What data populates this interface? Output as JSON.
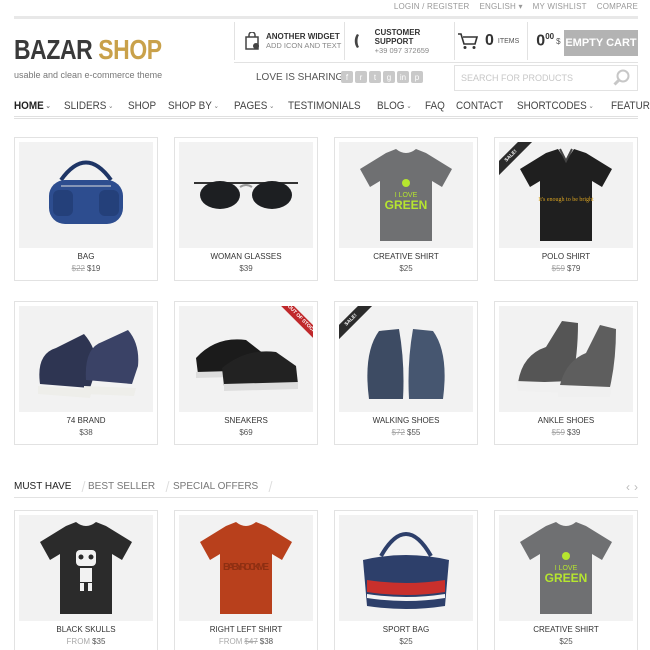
{
  "top_links": [
    "LOGIN / REGISTER",
    "ENGLISH ▾",
    "MY WISHLIST",
    "COMPARE"
  ],
  "logo": {
    "part1": "BAZAR",
    "part2": "SHOP",
    "tagline": "usable and clean e-commerce theme"
  },
  "widgets": [
    {
      "title": "ANOTHER WIDGET",
      "subtitle": "ADD ICON AND TEXT",
      "icon": "bag-icon"
    },
    {
      "title": "CUSTOMER SUPPORT",
      "subtitle": "+39 097 372659",
      "icon": "phone-icon"
    }
  ],
  "cart": {
    "count": "0",
    "items_label": "ITEMS",
    "total": "0",
    "cents": "00",
    "currency": "$",
    "button_label": "EMPTY CART"
  },
  "sharing": {
    "label": "LOVE IS SHARING",
    "icons": [
      "f",
      "r",
      "t",
      "g",
      "in",
      "p"
    ]
  },
  "search": {
    "placeholder": "SEARCH FOR PRODUCTS"
  },
  "nav": [
    {
      "label": "HOME",
      "dropdown": true,
      "active": true
    },
    {
      "label": "SLIDERS",
      "dropdown": true
    },
    {
      "label": "SHOP",
      "dropdown": false
    },
    {
      "label": "SHOP BY",
      "dropdown": true
    },
    {
      "label": "PAGES",
      "dropdown": true
    },
    {
      "label": "TESTIMONIALS",
      "dropdown": false
    },
    {
      "label": "BLOG",
      "dropdown": true
    },
    {
      "label": "FAQ",
      "dropdown": false
    },
    {
      "label": "CONTACT",
      "dropdown": false
    },
    {
      "label": "SHORTCODES",
      "dropdown": true
    },
    {
      "label": "FEATURES",
      "dropdown": false
    }
  ],
  "products_row1": [
    {
      "name": "BAG",
      "old_price": "$22",
      "price": "$19",
      "image": "bag",
      "ribbon": ""
    },
    {
      "name": "WOMAN GLASSES",
      "old_price": "",
      "price": "$39",
      "image": "glasses",
      "ribbon": ""
    },
    {
      "name": "CREATIVE SHIRT",
      "old_price": "",
      "price": "$25",
      "image": "shirt-grey",
      "ribbon": ""
    },
    {
      "name": "POLO SHIRT",
      "old_price": "$59",
      "price": "$79",
      "image": "polo",
      "ribbon": "SALE!"
    }
  ],
  "products_row2": [
    {
      "name": "74 BRAND",
      "old_price": "",
      "price": "$38",
      "image": "sneaker-navy",
      "ribbon": ""
    },
    {
      "name": "SNEAKERS",
      "old_price": "",
      "price": "$69",
      "image": "sneakers-black",
      "ribbon": "OUT OF STOCK"
    },
    {
      "name": "WALKING SHOES",
      "old_price": "$72",
      "price": "$55",
      "image": "boots",
      "ribbon": "SALE!"
    },
    {
      "name": "ANKLE SHOES",
      "old_price": "$59",
      "price": "$39",
      "image": "hightop",
      "ribbon": ""
    }
  ],
  "tabs": [
    "MUST HAVE",
    "BEST SELLER",
    "SPECIAL OFFERS"
  ],
  "arrows": {
    "prev": "‹",
    "next": "›"
  },
  "products_row3": [
    {
      "name": "BLACK SKULLS",
      "from": "FROM",
      "old_price": "",
      "price": "$35",
      "image": "tee-black"
    },
    {
      "name": "RIGHT LEFT SHIRT",
      "from": "FROM",
      "old_price": "$47",
      "price": "$38",
      "image": "tee-orange"
    },
    {
      "name": "SPORT BAG",
      "from": "",
      "old_price": "",
      "price": "$25",
      "image": "sport-bag"
    },
    {
      "name": "CREATIVE SHIRT",
      "from": "",
      "old_price": "",
      "price": "$25",
      "image": "shirt-grey"
    }
  ],
  "shirt_text": {
    "love": "I LOVE",
    "green": "GREEN",
    "polo": "It's enough to be bright",
    "baby": "BABY ROCK ME"
  },
  "colors": {
    "accent": "#c9a14a",
    "dark": "#3a3a3a",
    "sale_ribbon": "#2b2b2b",
    "stock_ribbon": "#c0282b",
    "button": "#b3b3b3"
  }
}
